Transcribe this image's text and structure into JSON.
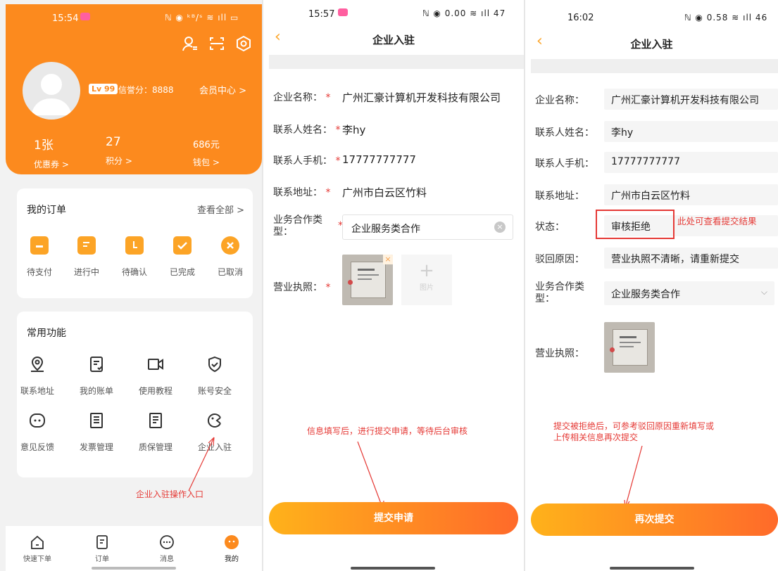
{
  "screen1": {
    "status": {
      "time": "15:54",
      "right": "ℕ ◉ ᵏᴮ/ˢ ≋ ıll ▭"
    },
    "level_badge": "Lv 99",
    "credit": "信誉分：8888",
    "member_center": "会员中心 >",
    "stats": [
      {
        "num": "1张",
        "label": "优惠券 >"
      },
      {
        "num": "27",
        "label": "积分 >"
      },
      {
        "num": "686元",
        "label": "钱包 >"
      }
    ],
    "orders": {
      "title": "我的订单",
      "more": "查看全部 >",
      "items": [
        {
          "label": "待支付",
          "icon": "wallet-icon"
        },
        {
          "label": "进行中",
          "icon": "doc-icon"
        },
        {
          "label": "待确认",
          "icon": "clock-icon"
        },
        {
          "label": "已完成",
          "icon": "check-icon"
        },
        {
          "label": "已取消",
          "icon": "close-icon"
        }
      ]
    },
    "functions": {
      "title": "常用功能",
      "items": [
        {
          "label": "联系地址",
          "icon": "location-icon"
        },
        {
          "label": "我的账单",
          "icon": "bill-icon"
        },
        {
          "label": "使用教程",
          "icon": "video-icon"
        },
        {
          "label": "账号安全",
          "icon": "shield-icon"
        },
        {
          "label": "意见反馈",
          "icon": "feedback-icon"
        },
        {
          "label": "发票管理",
          "icon": "invoice-icon"
        },
        {
          "label": "质保管理",
          "icon": "warranty-icon"
        },
        {
          "label": "企业入驻",
          "icon": "enterprise-icon"
        }
      ]
    },
    "annotation": "企业入驻操作入口",
    "tabs": [
      {
        "label": "快速下单",
        "icon": "home-icon"
      },
      {
        "label": "订单",
        "icon": "order-icon"
      },
      {
        "label": "消息",
        "icon": "message-icon"
      },
      {
        "label": "我的",
        "icon": "user-icon"
      }
    ],
    "accent": "#fc8a1e"
  },
  "screen2": {
    "status": {
      "time": "15:57",
      "right": "ℕ ◉ 0.00 ≋ ıll 47"
    },
    "title": "企业入驻",
    "fields": {
      "company": {
        "label": "企业名称：",
        "value": "广州汇豪计算机开发科技有限公司"
      },
      "contact": {
        "label": "联系人姓名：",
        "value": "李hy"
      },
      "phone": {
        "label": "联系人手机：",
        "value": "17777777777"
      },
      "address": {
        "label": "联系地址：",
        "value": "广州市白云区竹料"
      },
      "type": {
        "label": "业务合作类型：",
        "value": "企业服务类合作"
      },
      "license": {
        "label": "营业执照："
      }
    },
    "upload_label": "图片",
    "required_mark": "*",
    "annotation": "信息填写后，进行提交申请，等待后台审核",
    "submit": "提交申请"
  },
  "screen3": {
    "status": {
      "time": "16:02",
      "right": "ℕ ◉ 0.58 ≋ ıll 46"
    },
    "title": "企业入驻",
    "fields": {
      "company": {
        "label": "企业名称：",
        "value": "广州汇豪计算机开发科技有限公司"
      },
      "contact": {
        "label": "联系人姓名：",
        "value": "李hy"
      },
      "phone": {
        "label": "联系人手机：",
        "value": "17777777777"
      },
      "address": {
        "label": "联系地址：",
        "value": "广州市白云区竹料"
      },
      "status": {
        "label": "状态：",
        "value": "审核拒绝"
      },
      "reason": {
        "label": "驳回原因：",
        "value": "营业执照不清晰，请重新提交"
      },
      "type": {
        "label": "业务合作类型：",
        "value": "企业服务类合作"
      },
      "license": {
        "label": "营业执照："
      }
    },
    "status_note": "此处可查看提交结果",
    "annotation_line1": "提交被拒绝后，可参考驳回原因重新填写或",
    "annotation_line2": "上传相关信息再次提交",
    "submit": "再次提交"
  }
}
